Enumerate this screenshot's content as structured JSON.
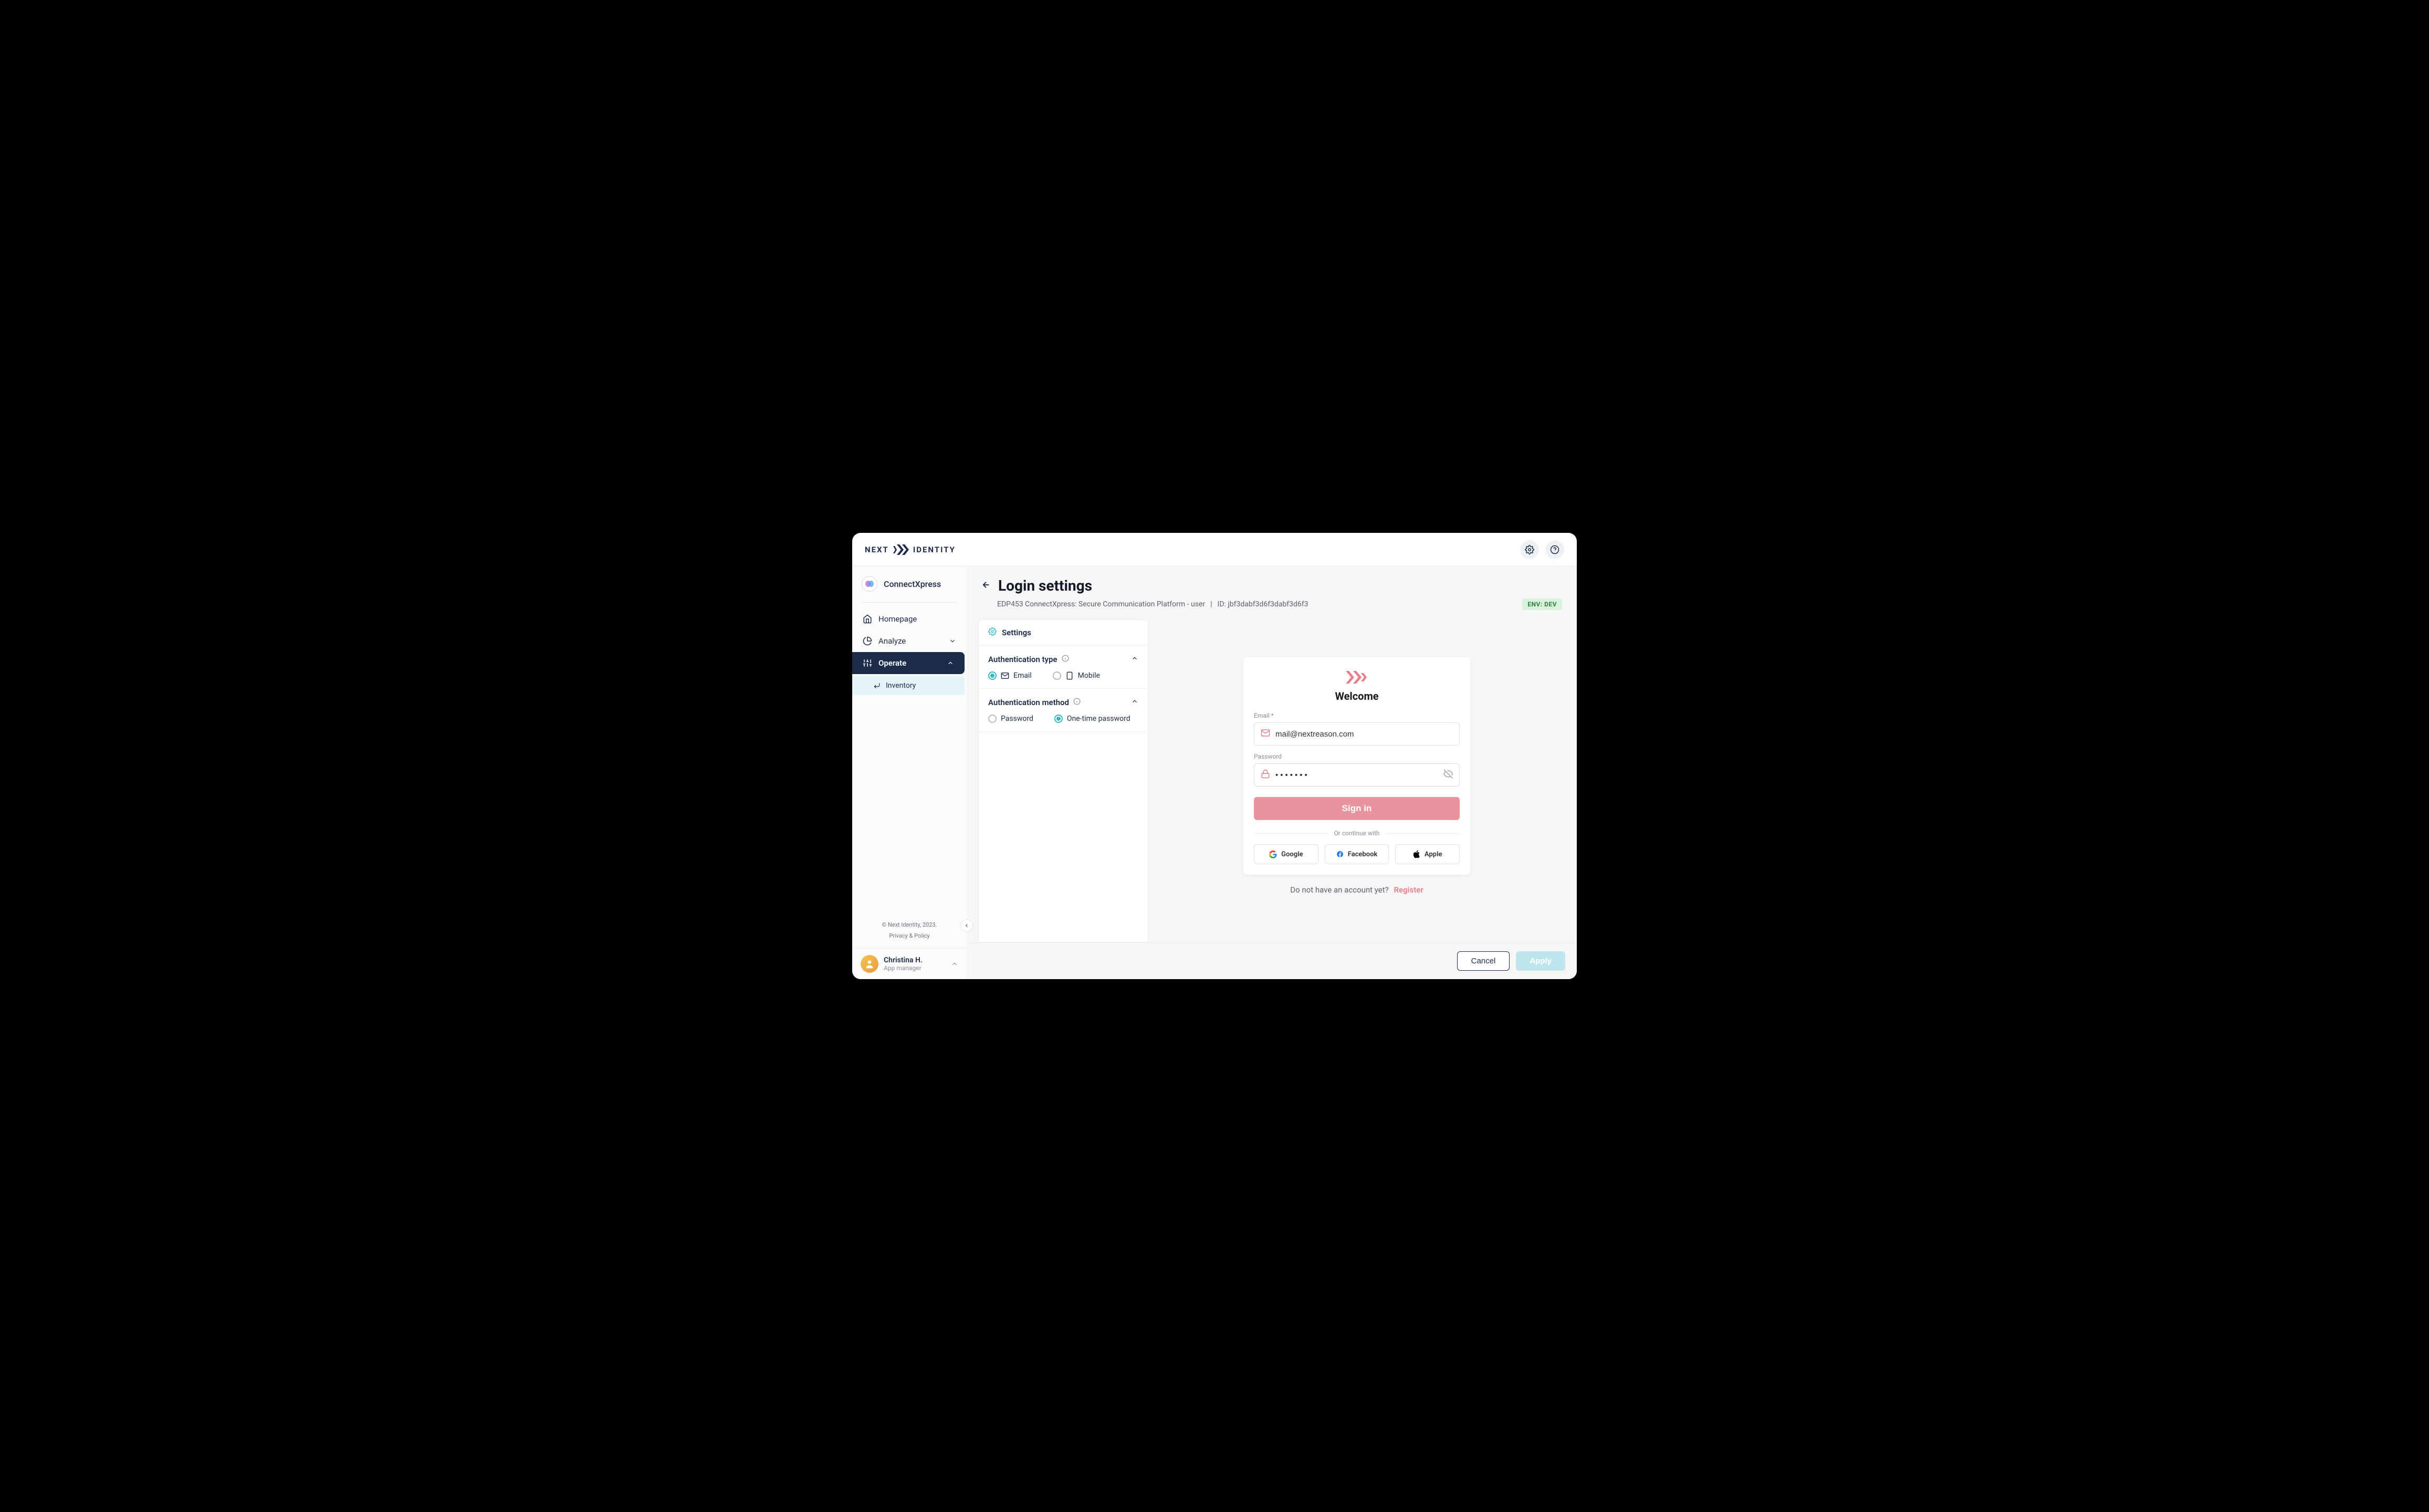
{
  "brand": {
    "name": "NEXT",
    "name2": "IDENTITY"
  },
  "project": {
    "name": "ConnectXpress"
  },
  "sidebar": {
    "items": [
      {
        "label": "Homepage",
        "icon": "home"
      },
      {
        "label": "Analyze",
        "icon": "pie",
        "expandable": true
      },
      {
        "label": "Operate",
        "icon": "sliders",
        "expandable": true,
        "active": true
      }
    ],
    "sub": {
      "label": "Inventory"
    },
    "footer": {
      "copyright": "© Next Identity, 2023.",
      "privacy": "Privacy & Policy"
    }
  },
  "user": {
    "name": "Christina H.",
    "role": "App manager"
  },
  "page": {
    "title": "Login settings",
    "subtitle": "EDP453 ConnectXpress: Secure Communication Platform - user",
    "id_label": "ID: jbf3dabf3d6f3dabf3d6f3",
    "env_label": "ENV:",
    "env_value": "DEV"
  },
  "settings": {
    "header": "Settings",
    "sections": [
      {
        "title": "Authentication type",
        "options": [
          {
            "label": "Email",
            "icon": "mail",
            "selected": true
          },
          {
            "label": "Mobile",
            "icon": "phone",
            "selected": false
          }
        ]
      },
      {
        "title": "Authentication method",
        "options": [
          {
            "label": "Password",
            "icon": null,
            "selected": false
          },
          {
            "label": "One-time password",
            "icon": null,
            "selected": true
          }
        ]
      }
    ]
  },
  "preview": {
    "welcome": "Welcome",
    "email_label": "Email *",
    "email_value": "mail@nextreason.com",
    "password_label": "Password",
    "password_value": "•••••••",
    "signin": "Sign in",
    "continue": "Or continue with",
    "social": {
      "google": "Google",
      "facebook": "Facebook",
      "apple": "Apple"
    },
    "register_prompt": "Do not have an account yet?",
    "register_link": "Register"
  },
  "footer": {
    "cancel": "Cancel",
    "apply": "Apply"
  }
}
